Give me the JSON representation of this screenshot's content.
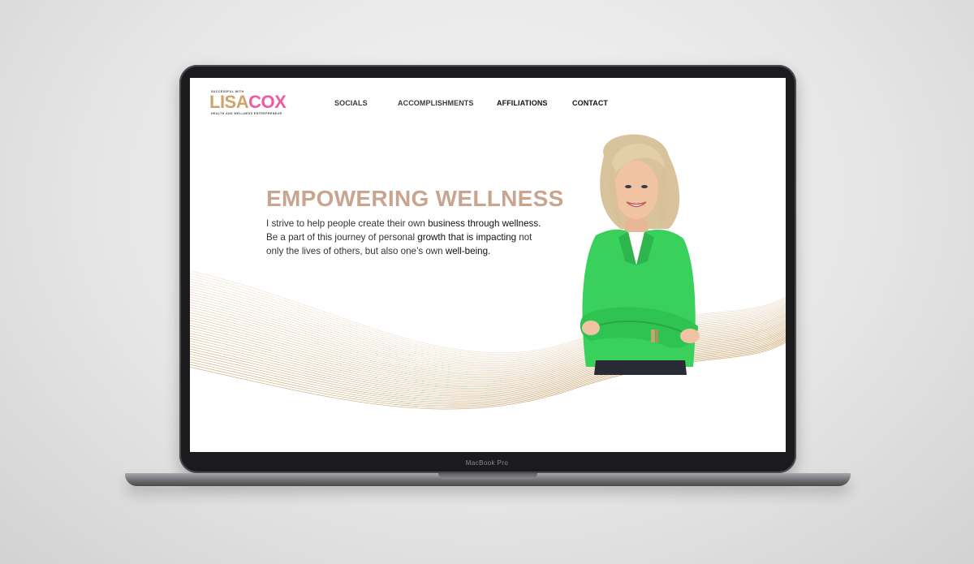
{
  "device": {
    "bezel_label": "MacBook Pro"
  },
  "logo": {
    "tagline": "SUCCESSFUL WITH",
    "first": "LISA",
    "last": "COX",
    "subtitle": "HEALTH AND WELLNESS ENTREPRENEUR"
  },
  "nav": {
    "items": [
      {
        "label": "SOCIALS",
        "color": "#3a3a3a"
      },
      {
        "label": "ACCOMPLISHMENTS",
        "color": "#3a3a3a"
      },
      {
        "label": "AFFILIATIONS",
        "color": "#111111"
      },
      {
        "label": "CONTACT",
        "color": "#111111"
      }
    ]
  },
  "hero": {
    "title": "EMPOWERING WELLNESS",
    "text_parts": [
      "I strive to help people create their own ",
      "business through wellness.",
      " Be a part of this journey of personal ",
      "growth that is impacting",
      " not only the lives of others, but also one’s own ",
      "well-being."
    ]
  },
  "colors": {
    "title": "#c9a48e",
    "logo_gold": "#cfa56a",
    "logo_pink": "#f15aa3",
    "jacket": "#39d05b",
    "wave_gold": "#c8a46d"
  },
  "icons": {
    "portrait": "woman-portrait-image",
    "decoration": "gold-wave-lines"
  }
}
